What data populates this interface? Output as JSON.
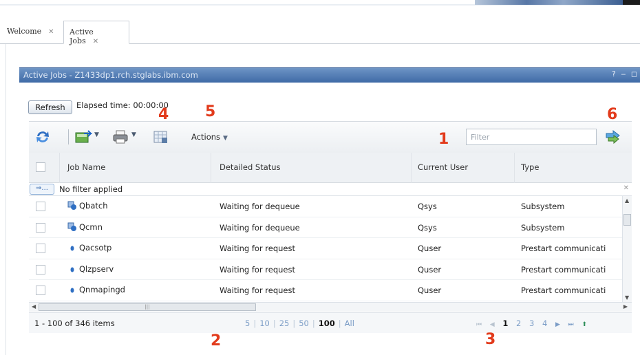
{
  "tabs": [
    {
      "label": "Welcome",
      "close": "✕"
    },
    {
      "label": "Active Jobs",
      "close": "✕"
    }
  ],
  "portlet": {
    "title": "Active Jobs - Z1433dp1.rch.stglabs.ibm.com",
    "controls": "? ‒ ◻"
  },
  "refresh_label": "Refresh",
  "elapsed": "Elapsed time: 00:00:00",
  "toolbar": {
    "actions_label": "Actions",
    "filter_placeholder": "Filter",
    "icons": [
      "refresh-icon",
      "export-icon",
      "print-icon",
      "table-config-icon",
      "filter-apply-icon"
    ]
  },
  "columns": [
    "Job Name",
    "Detailed Status",
    "Current User",
    "Type"
  ],
  "filter_row": {
    "button": "⇒...",
    "text": "No filter applied",
    "close": "✕"
  },
  "rows": [
    {
      "name": "Qbatch",
      "status": "Waiting for dequeue",
      "user": "Qsys",
      "type": "Subsystem",
      "icon": "subsystem-icon"
    },
    {
      "name": "Qcmn",
      "status": "Waiting for dequeue",
      "user": "Qsys",
      "type": "Subsystem",
      "icon": "subsystem-icon"
    },
    {
      "name": "Qacsotp",
      "status": "Waiting for request",
      "user": "Quser",
      "type": "Prestart communicati",
      "icon": "job-icon"
    },
    {
      "name": "Qlzpserv",
      "status": "Waiting for request",
      "user": "Quser",
      "type": "Prestart communicati",
      "icon": "job-icon"
    },
    {
      "name": "Qnmapingd",
      "status": "Waiting for request",
      "user": "Quser",
      "type": "Prestart communicati",
      "icon": "job-icon"
    }
  ],
  "footer": {
    "items": "1 - 100 of 346 items",
    "page_sizes": [
      "5",
      "10",
      "25",
      "50",
      "100",
      "All"
    ],
    "current_size": "100",
    "pages": [
      "1",
      "2",
      "3",
      "4"
    ],
    "current_page": "1"
  },
  "callouts": [
    "1",
    "2",
    "3",
    "4",
    "5",
    "6"
  ],
  "colors": {
    "header_blue": "#4a74ae",
    "callout_red": "#e23b1c",
    "link_blue": "#7a9cc6"
  }
}
